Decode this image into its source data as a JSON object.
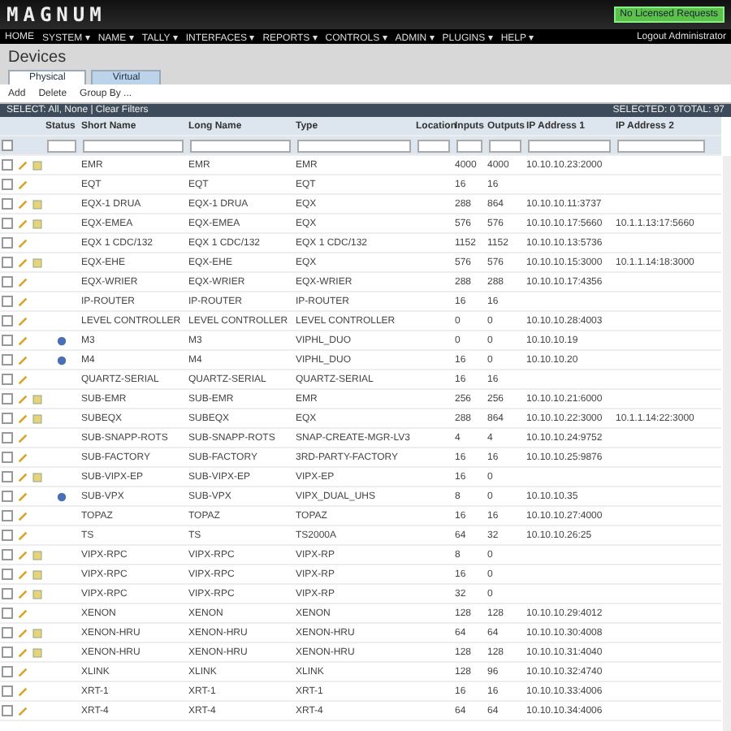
{
  "logo": "MAGNUM",
  "alert": "No Licensed Requests",
  "nav": [
    "HOME",
    "SYSTEM ▾",
    "NAME ▾",
    "TALLY ▾",
    "INTERFACES ▾",
    "REPORTS ▾",
    "CONTROLS ▾",
    "ADMIN ▾",
    "PLUGINS ▾",
    "HELP ▾"
  ],
  "user": "Logout Administrator",
  "title": "Devices",
  "tabs": [
    {
      "label": "Physical",
      "selected": true
    },
    {
      "label": "Virtual",
      "selected": false
    }
  ],
  "toolbar": [
    "Add",
    "Delete",
    "Group By ..."
  ],
  "select_bar": "SELECT: All, None | Clear Filters",
  "totals": "SELECTED: 0   TOTAL: 97",
  "select_all": {
    "checked": false
  },
  "columns": [
    "Status",
    "Short Name",
    "Long Name",
    "Type",
    "Location",
    "Inputs",
    "Outputs",
    "IP Address 1",
    "IP Address 2"
  ],
  "rows": [
    {
      "checked": false,
      "configured": true,
      "connected": false,
      "short": "EMR",
      "long": "EMR",
      "type": "EMR",
      "inputs": "4000",
      "outputs": "4000",
      "ip1": "10.10.10.23:2000"
    },
    {
      "checked": false,
      "configured": false,
      "connected": false,
      "short": "EQT",
      "long": "EQT",
      "type": "EQT",
      "inputs": "16",
      "outputs": "16"
    },
    {
      "checked": false,
      "configured": true,
      "connected": false,
      "short": "EQX-1 DRUA",
      "long": "EQX-1 DRUA",
      "type": "EQX",
      "inputs": "288",
      "outputs": "864",
      "ip1": "10.10.10.11:3737"
    },
    {
      "checked": false,
      "configured": true,
      "connected": false,
      "short": "EQX-EMEA",
      "long": "EQX-EMEA",
      "type": "EQX",
      "inputs": "576",
      "outputs": "576",
      "ip1": "10.10.10.17:5660",
      "ip2": "10.1.1.13:17:5660"
    },
    {
      "checked": false,
      "configured": false,
      "connected": false,
      "short": "EQX 1 CDC/132",
      "long": "EQX 1 CDC/132",
      "type": "EQX 1 CDC/132",
      "inputs": "1152",
      "outputs": "1152",
      "ip1": "10.10.10.13:5736"
    },
    {
      "checked": false,
      "configured": true,
      "connected": false,
      "short": "EQX-EHE",
      "long": "EQX-EHE",
      "type": "EQX",
      "inputs": "576",
      "outputs": "576",
      "ip1": "10.10.10.15:3000",
      "ip2": "10.1.1.14:18:3000"
    },
    {
      "checked": false,
      "configured": false,
      "connected": false,
      "short": "EQX-WRIER",
      "long": "EQX-WRIER",
      "type": "EQX-WRIER",
      "inputs": "288",
      "outputs": "288",
      "ip1": "10.10.10.17:4356"
    },
    {
      "checked": false,
      "configured": false,
      "connected": false,
      "short": "IP-ROUTER",
      "long": "IP-ROUTER",
      "type": "IP-ROUTER",
      "inputs": "16",
      "outputs": "16"
    },
    {
      "checked": false,
      "configured": false,
      "connected": false,
      "short": "LEVEL CONTROLLER",
      "long": "LEVEL CONTROLLER",
      "type": "LEVEL CONTROLLER",
      "inputs": "0",
      "outputs": "0",
      "ip1": "10.10.10.28:4003"
    },
    {
      "checked": false,
      "configured": false,
      "connected": true,
      "short": "M3",
      "long": "M3",
      "type": "VIPHL_DUO",
      "inputs": "0",
      "outputs": "0",
      "ip1": "10.10.10.19"
    },
    {
      "checked": false,
      "configured": false,
      "connected": true,
      "short": "M4",
      "long": "M4",
      "type": "VIPHL_DUO",
      "inputs": "16",
      "outputs": "0",
      "ip1": "10.10.10.20"
    },
    {
      "checked": false,
      "configured": false,
      "connected": false,
      "short": "QUARTZ-SERIAL",
      "long": "QUARTZ-SERIAL",
      "type": "QUARTZ-SERIAL",
      "inputs": "16",
      "outputs": "16"
    },
    {
      "checked": false,
      "configured": true,
      "connected": false,
      "short": "SUB-EMR",
      "long": "SUB-EMR",
      "type": "EMR",
      "inputs": "256",
      "outputs": "256",
      "ip1": "10.10.10.21:6000"
    },
    {
      "checked": false,
      "configured": true,
      "connected": false,
      "short": "SUBEQX",
      "long": "SUBEQX",
      "type": "EQX",
      "inputs": "288",
      "outputs": "864",
      "ip1": "10.10.10.22:3000",
      "ip2": "10.1.1.14:22:3000"
    },
    {
      "checked": false,
      "configured": false,
      "connected": false,
      "short": "SUB-SNAPP-ROTS",
      "long": "SUB-SNAPP-ROTS",
      "type": "SNAP-CREATE-MGR-LV3",
      "inputs": "4",
      "outputs": "4",
      "ip1": "10.10.10.24:9752"
    },
    {
      "checked": false,
      "configured": false,
      "connected": false,
      "short": "SUB-FACTORY",
      "long": "SUB-FACTORY",
      "type": "3RD-PARTY-FACTORY",
      "inputs": "16",
      "outputs": "16",
      "ip1": "10.10.10.25:9876"
    },
    {
      "checked": false,
      "configured": true,
      "connected": false,
      "short": "SUB-VIPX-EP",
      "long": "SUB-VIPX-EP",
      "type": "VIPX-EP",
      "inputs": "16",
      "outputs": "0"
    },
    {
      "checked": false,
      "configured": false,
      "connected": true,
      "short": "SUB-VPX",
      "long": "SUB-VPX",
      "type": "VIPX_DUAL_UHS",
      "inputs": "8",
      "outputs": "0",
      "ip1": "10.10.10.35"
    },
    {
      "checked": false,
      "configured": false,
      "connected": false,
      "short": "TOPAZ",
      "long": "TOPAZ",
      "type": "TOPAZ",
      "inputs": "16",
      "outputs": "16",
      "ip1": "10.10.10.27:4000"
    },
    {
      "checked": false,
      "configured": false,
      "connected": false,
      "short": "TS",
      "long": "TS",
      "type": "TS2000A",
      "inputs": "64",
      "outputs": "32",
      "ip1": "10.10.10.26:25"
    },
    {
      "checked": false,
      "configured": true,
      "connected": false,
      "short": "VIPX-RPC",
      "long": "VIPX-RPC",
      "type": "VIPX-RP",
      "inputs": "8",
      "outputs": "0"
    },
    {
      "checked": false,
      "configured": true,
      "connected": false,
      "short": "VIPX-RPC",
      "long": "VIPX-RPC",
      "type": "VIPX-RP",
      "inputs": "16",
      "outputs": "0"
    },
    {
      "checked": false,
      "configured": true,
      "connected": false,
      "short": "VIPX-RPC",
      "long": "VIPX-RPC",
      "type": "VIPX-RP",
      "inputs": "32",
      "outputs": "0"
    },
    {
      "checked": false,
      "configured": false,
      "connected": false,
      "short": "XENON",
      "long": "XENON",
      "type": "XENON",
      "inputs": "128",
      "outputs": "128",
      "ip1": "10.10.10.29:4012"
    },
    {
      "checked": false,
      "configured": true,
      "connected": false,
      "short": "XENON-HRU",
      "long": "XENON-HRU",
      "type": "XENON-HRU",
      "inputs": "64",
      "outputs": "64",
      "ip1": "10.10.10.30:4008"
    },
    {
      "checked": false,
      "configured": true,
      "connected": false,
      "short": "XENON-HRU",
      "long": "XENON-HRU",
      "type": "XENON-HRU",
      "inputs": "128",
      "outputs": "128",
      "ip1": "10.10.10.31:4040"
    },
    {
      "checked": false,
      "configured": false,
      "connected": false,
      "short": "XLINK",
      "long": "XLINK",
      "type": "XLINK",
      "inputs": "128",
      "outputs": "96",
      "ip1": "10.10.10.32:4740"
    },
    {
      "checked": false,
      "configured": false,
      "connected": false,
      "short": "XRT-1",
      "long": "XRT-1",
      "type": "XRT-1",
      "inputs": "16",
      "outputs": "16",
      "ip1": "10.10.10.33:4006"
    },
    {
      "checked": false,
      "configured": false,
      "connected": false,
      "short": "XRT-4",
      "long": "XRT-4",
      "type": "XRT-4",
      "inputs": "64",
      "outputs": "64",
      "ip1": "10.10.10.34:4006"
    }
  ]
}
